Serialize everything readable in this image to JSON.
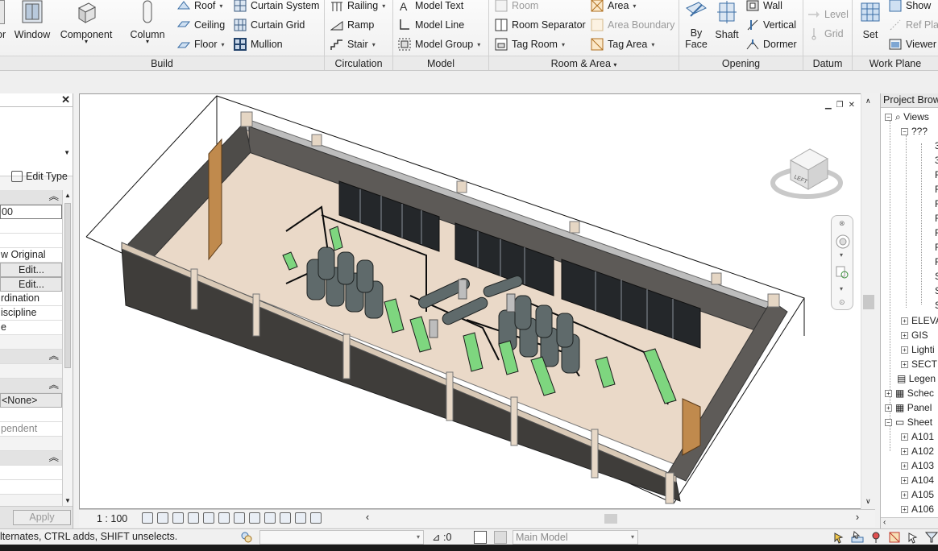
{
  "ribbon": {
    "build": {
      "door_partial": "or",
      "window": "Window",
      "component": "Component",
      "column": "Column",
      "roof": "Roof",
      "ceiling": "Ceiling",
      "floor": "Floor",
      "curtain_system": "Curtain System",
      "curtain_grid": "Curtain Grid",
      "mullion": "Mullion",
      "panel_label": "Build"
    },
    "circulation": {
      "railing": "Railing",
      "ramp": "Ramp",
      "stair": "Stair",
      "panel_label": "Circulation"
    },
    "model": {
      "model_text": "Model Text",
      "model_line": "Model Line",
      "model_group": "Model Group",
      "panel_label": "Model"
    },
    "room_area": {
      "room": "Room",
      "room_separator": "Room Separator",
      "tag_room": "Tag Room",
      "area": "Area",
      "area_boundary": "Area Boundary",
      "tag_area": "Tag Area",
      "panel_label": "Room & Area"
    },
    "opening": {
      "by_face": "By Face",
      "by_face_l1": "By",
      "by_face_l2": "Face",
      "shaft": "Shaft",
      "wall": "Wall",
      "vertical": "Vertical",
      "dormer": "Dormer",
      "panel_label": "Opening"
    },
    "datum": {
      "level": "Level",
      "grid": "Grid",
      "panel_label": "Datum"
    },
    "work_plane": {
      "set": "Set",
      "show": "Show",
      "ref_plane": "Ref Pla",
      "viewer": "Viewer",
      "panel_label": "Work Plane"
    }
  },
  "properties": {
    "edit_type": "Edit Type",
    "rows": [
      "00",
      "",
      "",
      "w Original",
      "Edit...",
      "Edit...",
      "rdination",
      "iscipline",
      "e"
    ],
    "none_value": "<None>",
    "dependent": "pendent",
    "apply": "Apply"
  },
  "viewport": {
    "scale": "1 : 100",
    "viewcube_face": "LEFT"
  },
  "project_browser": {
    "title": "Project Browser",
    "views": "Views",
    "group": "???",
    "elevations": "ELEVA",
    "gis": "GIS",
    "lighting": "Lighti",
    "sections": "SECTI",
    "legends": "Legen",
    "schedules": "Schec",
    "panels": "Panel",
    "sheets": "Sheet",
    "view_leaf_labels": [
      "3",
      "3",
      "F",
      "F",
      "F",
      "F",
      "F",
      "F",
      "R",
      "S",
      "S",
      "S"
    ],
    "sheet_items": [
      "A101",
      "A102",
      "A103",
      "A104",
      "A105",
      "A106"
    ]
  },
  "status": {
    "message": "lternates, CTRL adds, SHIFT unselects.",
    "selection_count": ":0",
    "model": "Main Model"
  }
}
